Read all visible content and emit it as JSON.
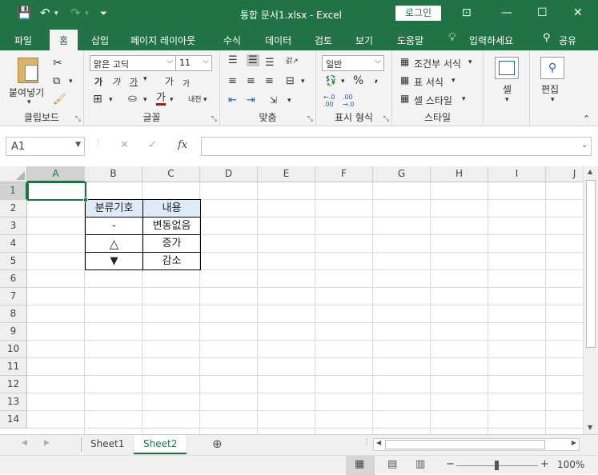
{
  "titlebar": {
    "title": "통합 문서1.xlsx  -  Excel",
    "login_label": "로그인",
    "save_icon": "💾",
    "undo_icon": "↶",
    "redo_icon": "↷",
    "customize_icon": "⏷",
    "ribbon_display_icon": "⊡",
    "minimize_icon": "—",
    "maximize_icon": "☐",
    "close_icon": "✕"
  },
  "tabs": [
    {
      "label": "파일"
    },
    {
      "label": "홈"
    },
    {
      "label": "삽입"
    },
    {
      "label": "페이지 레이아웃"
    },
    {
      "label": "수식"
    },
    {
      "label": "데이터"
    },
    {
      "label": "검토"
    },
    {
      "label": "보기"
    },
    {
      "label": "도움말"
    },
    {
      "label": "입력하세요"
    },
    {
      "label": "공유"
    }
  ],
  "ribbon": {
    "clipboard": {
      "label": "클립보드",
      "paste": "붙여넣기"
    },
    "font": {
      "label": "글꼴",
      "name": "맑은 고딕",
      "size": "11",
      "bold": "가",
      "italic": "가",
      "underline": "가",
      "grow": "가",
      "shrink": "가",
      "color_letter": "가",
      "phonetic": "내천"
    },
    "alignment": {
      "label": "맞춤"
    },
    "number": {
      "label": "표시 형식",
      "format": "일반",
      "percent": "%",
      "comma": " ,",
      "inc_dec": "←.0\n.00",
      "dec_dec": ".00\n→.0"
    },
    "styles": {
      "label": "스타일",
      "conditional": "조건부 서식",
      "table": "표 서식",
      "cell_style": "셀 스타일"
    },
    "cells": {
      "label": "셀"
    },
    "editing": {
      "label": "편집"
    }
  },
  "formula_bar": {
    "name_box": "A1",
    "cancel_icon": "✕",
    "enter_icon": "✓",
    "fx": "fx",
    "value": ""
  },
  "sheet": {
    "columns": [
      "A",
      "B",
      "C",
      "D",
      "E",
      "F",
      "G",
      "H",
      "I",
      "J"
    ],
    "rows": [
      "1",
      "2",
      "3",
      "4",
      "5",
      "6",
      "7",
      "8",
      "9",
      "10",
      "11",
      "12",
      "13",
      "14"
    ],
    "cells": {
      "B2": "분류기호",
      "C2": "내용",
      "B3": "-",
      "C3": "변동없음",
      "B4": "△",
      "C4": "증가",
      "B5": "▼",
      "C5": "감소"
    },
    "header_fill": "#ddebf7"
  },
  "sheet_tabs": [
    {
      "label": "Sheet1"
    },
    {
      "label": "Sheet2"
    }
  ],
  "statusbar": {
    "zoom": "100%",
    "minus": "−",
    "plus": "+"
  },
  "colors": {
    "accent": "#217346"
  }
}
